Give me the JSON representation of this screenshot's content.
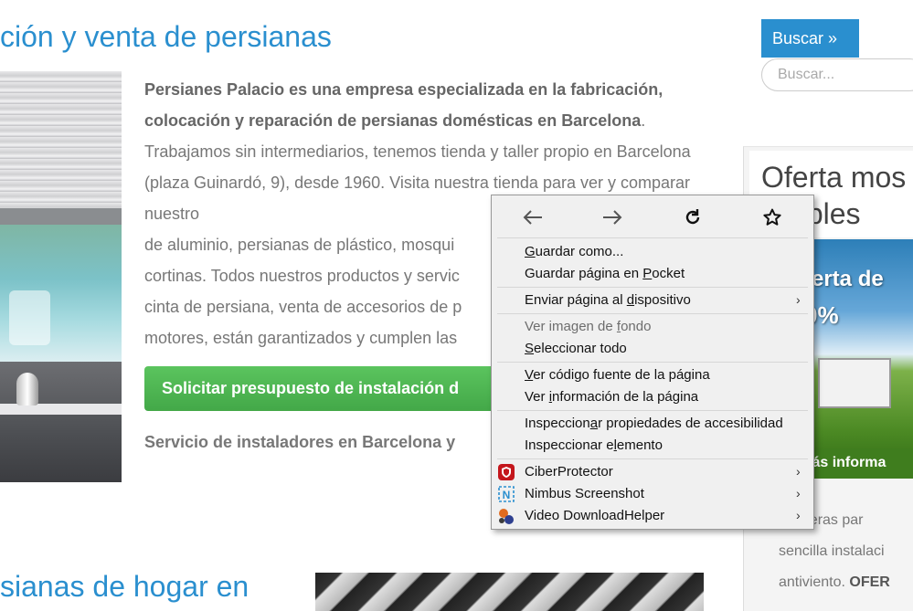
{
  "page": {
    "title": "ción y venta de persianas",
    "intro_bold": "Persianes Palacio es una empresa especializada en la fabricación, colocación y reparación de persianas domésticas en Barcelona",
    "intro_rest": ". Trabajamos sin intermediarios, tenemos tienda y taller propio en Barcelona (plaza Guinardó, 9), desde 1960. Visita nuestra tienda para ver y comparar nuestro",
    "intro_lines_visible": [
      "de aluminio, persianas de plástico, mosqui",
      "cortinas. Todos nuestros productos y servic",
      "cinta de persiana, venta de accesorios de p",
      "motores, están garantizados y cumplen las"
    ],
    "cta_label": "Solicitar presupuesto de instalación d",
    "installers_text": "Servicio de instaladores en Barcelona y",
    "section_title": "sianas de hogar en"
  },
  "sidebar": {
    "search_button_label": "Buscar »",
    "search_placeholder": "Buscar...",
    "offer_title_line1": "Oferta mos",
    "offer_title_line2": "ollables",
    "banner_line1": "ferta de",
    "banner_line2": "0%",
    "banner_more": "lás informa",
    "text_line1": "squiteras par",
    "text_line2": "sencilla instalaci",
    "text_line3_plain": "antiviento. ",
    "text_line3_bold": "OFER"
  },
  "context_menu": {
    "nav": {
      "back_icon": "arrow-left-icon",
      "forward_icon": "arrow-right-icon",
      "reload_icon": "reload-icon",
      "bookmark_icon": "star-icon"
    },
    "items": [
      {
        "label": "Guardar como...",
        "disabled": false,
        "submenu": false
      },
      {
        "label": "Guardar página en Pocket",
        "disabled": false,
        "submenu": false
      },
      {
        "label": "Enviar página al dispositivo",
        "disabled": false,
        "submenu": true
      },
      {
        "label": "Ver imagen de fondo",
        "disabled": true,
        "submenu": false
      },
      {
        "label": "Seleccionar todo",
        "disabled": false,
        "submenu": false
      },
      {
        "label": "Ver código fuente de la página",
        "disabled": false,
        "submenu": false
      },
      {
        "label": "Ver información de la página",
        "disabled": false,
        "submenu": false
      },
      {
        "label": "Inspeccionar propiedades de accesibilidad",
        "disabled": false,
        "submenu": false
      },
      {
        "label": "Inspeccionar elemento",
        "disabled": false,
        "submenu": false
      },
      {
        "label": "CiberProtector",
        "disabled": false,
        "submenu": true,
        "icon": "shield-icon"
      },
      {
        "label": "Nimbus Screenshot",
        "disabled": false,
        "submenu": true,
        "icon": "nimbus-icon"
      },
      {
        "label": "Video DownloadHelper",
        "disabled": false,
        "submenu": true,
        "icon": "molecule-icon"
      }
    ],
    "submenu_glyph": "›"
  },
  "colors": {
    "link_blue": "#2a8fcf",
    "cta_green": "#4cb450",
    "highlight_yellow": "#ffff27",
    "menu_bg": "#f0f0f0"
  }
}
